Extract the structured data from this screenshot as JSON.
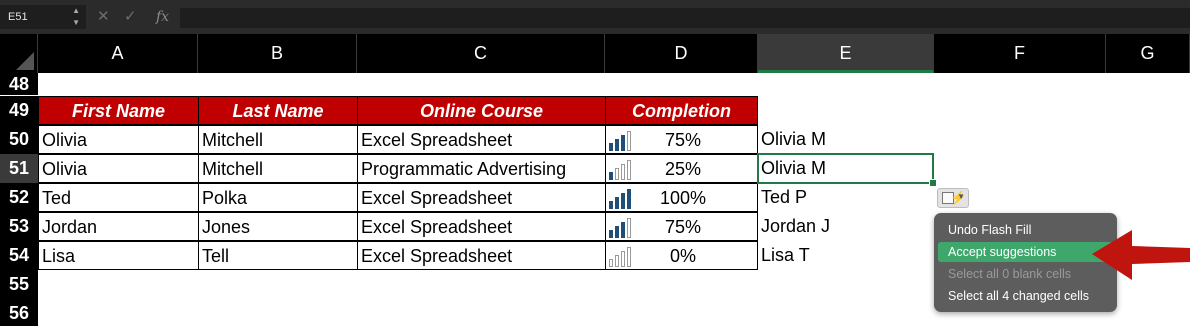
{
  "formula_bar": {
    "name_box": "E51",
    "cancel_glyph": "✕",
    "confirm_glyph": "✓",
    "fx_label": "fx",
    "formula": ""
  },
  "columns": [
    "A",
    "B",
    "C",
    "D",
    "E",
    "F",
    "G"
  ],
  "selected_column": "E",
  "rows": [
    "48",
    "49",
    "50",
    "51",
    "52",
    "53",
    "54",
    "55",
    "56"
  ],
  "selected_row": "51",
  "table": {
    "headers": [
      "First Name",
      "Last Name",
      "Online Course",
      "Completion"
    ],
    "records": [
      {
        "first": "Olivia",
        "last": "Mitchell",
        "course": "Excel Spreadsheet",
        "completion": "75%",
        "bars": 3
      },
      {
        "first": "Olivia",
        "last": "Mitchell",
        "course": "Programmatic Advertising",
        "completion": "25%",
        "bars": 1
      },
      {
        "first": "Ted",
        "last": "Polka",
        "course": "Excel Spreadsheet",
        "completion": "100%",
        "bars": 4
      },
      {
        "first": "Jordan",
        "last": "Jones",
        "course": "Excel Spreadsheet",
        "completion": "75%",
        "bars": 3
      },
      {
        "first": "Lisa",
        "last": "Tell",
        "course": "Excel Spreadsheet",
        "completion": "0%",
        "bars": 0
      }
    ]
  },
  "flash_fill_values": [
    "Olivia M",
    "Olivia M",
    "Ted P",
    "Jordan J",
    "Lisa T"
  ],
  "flash_fill_menu": {
    "items": [
      {
        "label": "Undo Flash Fill",
        "state": "normal"
      },
      {
        "label": "Accept suggestions",
        "state": "highlighted"
      },
      {
        "label": "Select all 0 blank cells",
        "state": "disabled"
      },
      {
        "label": "Select all 4 changed cells",
        "state": "normal"
      }
    ]
  },
  "colors": {
    "header_fill": "#c00000",
    "selection": "#1f7a45",
    "menu_highlight": "#3ea86c",
    "arrow": "#c0140f",
    "databar": "#1f4e79"
  },
  "icons": [
    "cancel-icon",
    "confirm-icon",
    "fx-icon",
    "flash-fill-options-icon",
    "pointer-arrow"
  ]
}
